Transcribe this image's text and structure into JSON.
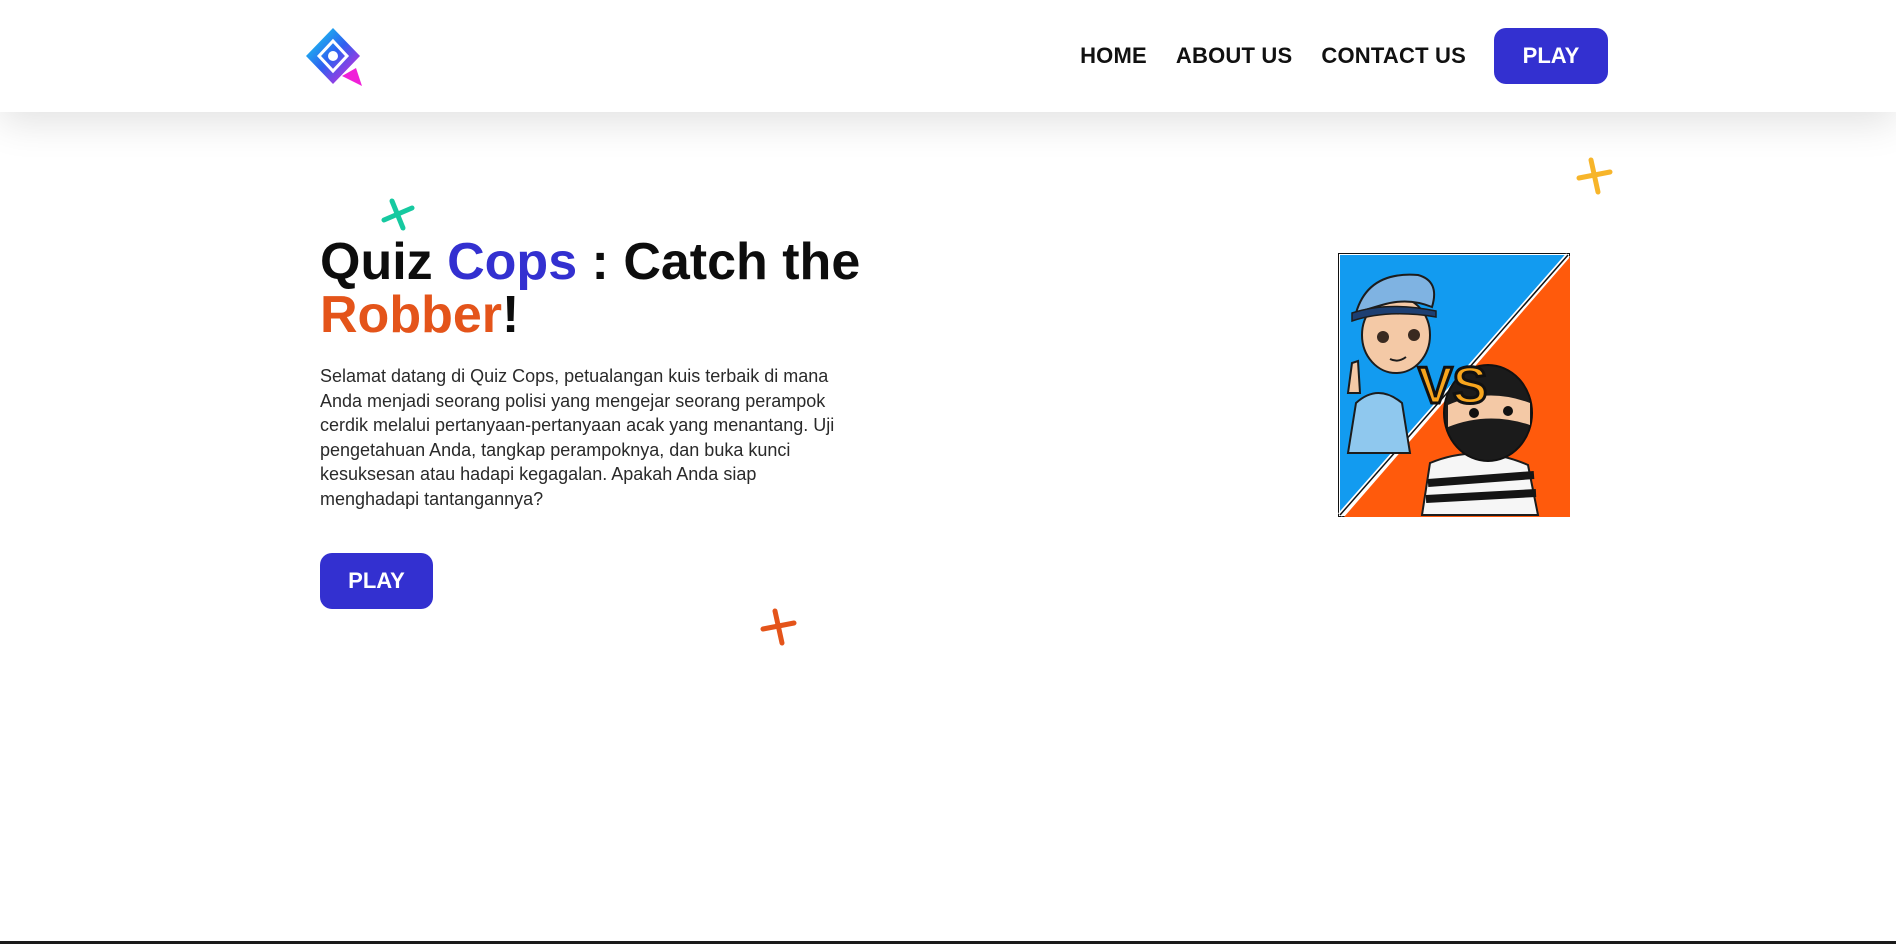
{
  "nav": {
    "links": [
      "HOME",
      "ABOUT US",
      "CONTACT US"
    ],
    "play_label": "PLAY"
  },
  "hero": {
    "title_part1": "Quiz ",
    "title_part2": "Cops",
    "title_part3": " : Catch the ",
    "title_part4": "Robber",
    "title_part5": "!",
    "description": "Selamat datang di Quiz Cops, petualangan kuis terbaik di mana Anda menjadi seorang polisi yang mengejar seorang perampok cerdik melalui pertanyaan-pertanyaan acak yang menantang. Uji pengetahuan Anda, tangkap perampoknya, dan buka kunci kesuksesan atau hadapi kegagalan. Apakah Anda siap menghadapi tantangannya?",
    "play_label": "PLAY"
  },
  "image": {
    "vs_text": "VS"
  },
  "icons": {
    "logo": "quiz-logo-icon",
    "sparkles": [
      "green-cross-icon",
      "yellow-cross-icon",
      "red-cross-icon"
    ]
  },
  "colors": {
    "primary": "#3330d0",
    "accent_orange": "#e4541a",
    "sparkle_green": "#16c9a0",
    "sparkle_yellow": "#f7b52a",
    "sparkle_red": "#e4541a",
    "cop_panel": "#129bf0",
    "robber_panel": "#ff5a0c"
  }
}
